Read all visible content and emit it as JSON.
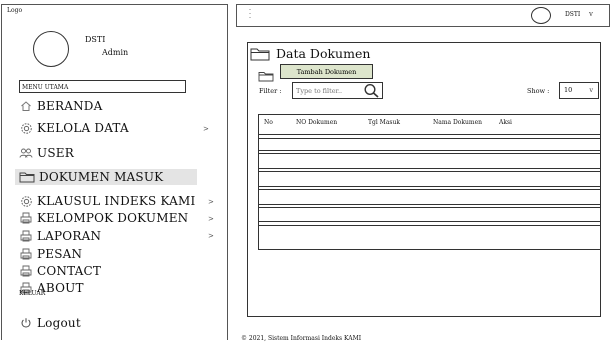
{
  "header": {
    "logo": "Logo",
    "user": "DSTI",
    "menu_icon": "hamburger-icon",
    "caret_icon": "chevron-down-icon"
  },
  "profile": {
    "name": "DSTI",
    "role": "Admin"
  },
  "sidebar": {
    "section_label": "MENU UTAMA",
    "items": [
      {
        "label": "BERANDA",
        "icon": "home-icon",
        "chevron": ""
      },
      {
        "label": "KELOLA DATA",
        "icon": "gear-icon",
        "chevron": ">"
      },
      {
        "label": "USER",
        "icon": "users-icon",
        "chevron": ""
      },
      {
        "label": "DOKUMEN MASUK",
        "icon": "folder-icon",
        "chevron": ""
      },
      {
        "label": "KLAUSUL INDEKS KAMI",
        "icon": "gear-icon",
        "chevron": ">"
      },
      {
        "label": "KELOMPOK DOKUMEN",
        "icon": "printer-icon",
        "chevron": ">"
      },
      {
        "label": "LAPORAN",
        "icon": "printer-icon",
        "chevron": ">"
      },
      {
        "label": "PESAN",
        "icon": "printer-icon",
        "chevron": ""
      },
      {
        "label": "CONTACT",
        "icon": "printer-icon",
        "chevron": ""
      },
      {
        "label": "ABOUT",
        "icon": "printer-icon",
        "chevron": ""
      }
    ],
    "exit_label": "KELUAR",
    "logout_label": "Logout",
    "logout_icon": "power-icon"
  },
  "main": {
    "title": "Data Dokumen",
    "add_button": "Tambah Dokumen",
    "filter_label": "Filter :",
    "filter_placeholder": "Type to filter..",
    "show_label": "Show :",
    "show_value": "10",
    "columns": [
      "No",
      "NO Dokumen",
      "Tgl Masuk",
      "Nama Dokumen",
      "Aksi"
    ]
  },
  "footer": {
    "text": "© 2021, Sistem Informasi Indeks KAMI"
  }
}
